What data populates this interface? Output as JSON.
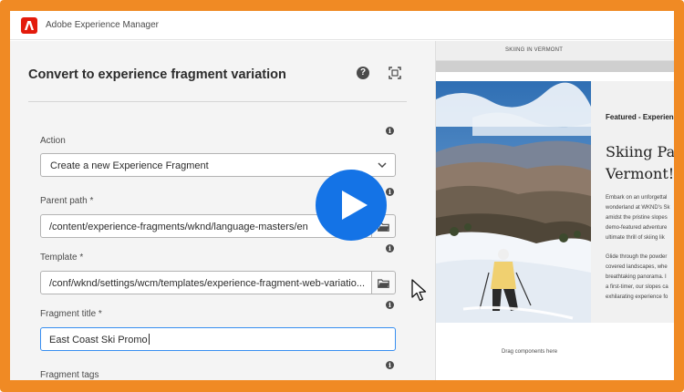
{
  "app": {
    "title": "Adobe Experience Manager"
  },
  "dialog": {
    "title": "Convert to experience fragment variation",
    "action": {
      "label": "Action",
      "value": "Create a new Experience Fragment"
    },
    "parent_path": {
      "label": "Parent path *",
      "value": "/content/experience-fragments/wknd/language-masters/en"
    },
    "template": {
      "label": "Template *",
      "value": "/conf/wknd/settings/wcm/templates/experience-fragment-web-variatio..."
    },
    "fragment_title": {
      "label": "Fragment title *",
      "value": "East Coast Ski Promo"
    },
    "fragment_tags": {
      "label": "Fragment tags"
    }
  },
  "preview": {
    "header": "SKIING IN VERMONT",
    "featured": "Featured - Experien",
    "headline_line1": "Skiing Par",
    "headline_line2": "Vermont!",
    "paragraph1": [
      "Embark on an unforgettal",
      "wonderland at WKND's Sk",
      "amidst the pristine slopes",
      "demo-featured adventure",
      "ultimate thrill of skiing lik"
    ],
    "paragraph2": [
      "Glide through the powder",
      "covered landscapes, whe",
      "breathtaking panorama. I",
      "a first-timer, our slopes ca",
      "exhilarating experience fo"
    ],
    "drag_hint": "Drag components here"
  },
  "icons": {
    "help": "help-icon",
    "fullscreen": "fullscreen-icon",
    "info": "info-icon",
    "folder": "folder-icon",
    "chevron": "chevron-down-icon",
    "play": "play-icon",
    "cursor": "mouse-cursor-icon"
  },
  "colors": {
    "accent": "#1473e6",
    "frame": "#f08a24",
    "adobe_red": "#e31b0c"
  }
}
